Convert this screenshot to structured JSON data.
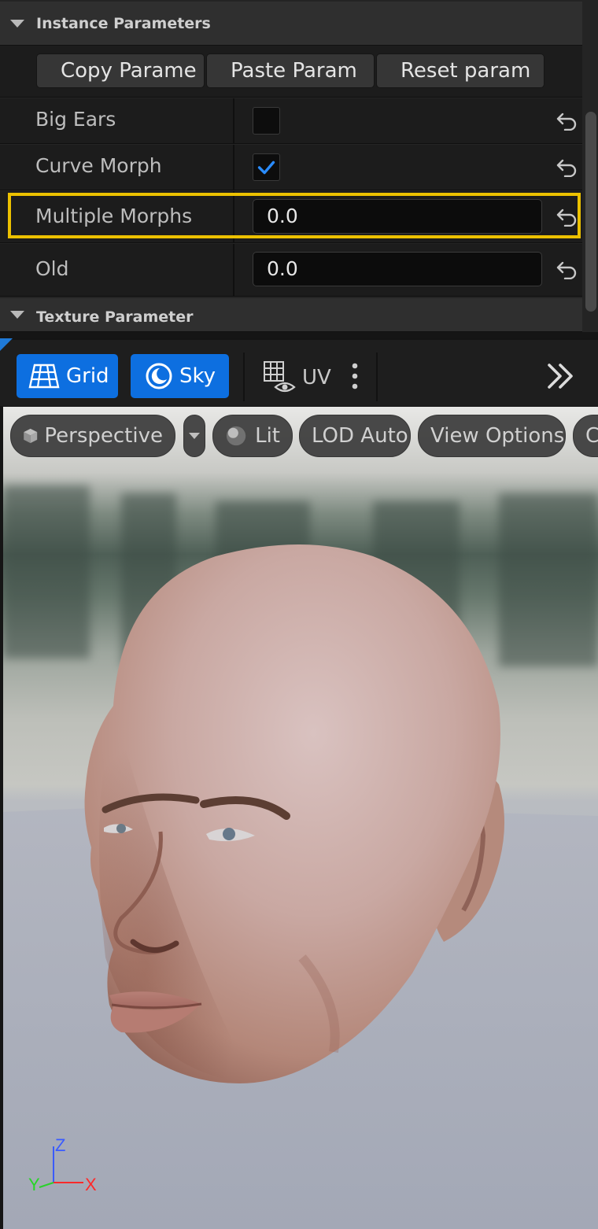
{
  "details": {
    "instance_section_title": "Instance Parameters",
    "buttons": {
      "copy": "Copy Parame",
      "paste": "Paste Param",
      "reset": "Reset param"
    },
    "params": [
      {
        "name": "Big Ears",
        "type": "checkbox",
        "checked": false
      },
      {
        "name": "Curve Morph",
        "type": "checkbox",
        "checked": true
      },
      {
        "name": "Multiple Morphs",
        "type": "scalar",
        "value": "0.0",
        "highlighted": true
      },
      {
        "name": "Old",
        "type": "scalar",
        "value": "0.0"
      }
    ],
    "texture_section_title": "Texture Parameter",
    "colors": {
      "highlight": "#ecc100",
      "accent": "#0d6fe0",
      "check": "#2a8cff"
    }
  },
  "toolbar": {
    "grid_label": "Grid",
    "sky_label": "Sky",
    "uv_label": "UV"
  },
  "viewport": {
    "perspective_label": "Perspective",
    "lit_label": "Lit",
    "lod_label": "LOD Auto",
    "view_options_label": "View Options",
    "overflow_label": "C",
    "axis": {
      "z": "Z",
      "y": "Y",
      "x": "X"
    }
  }
}
